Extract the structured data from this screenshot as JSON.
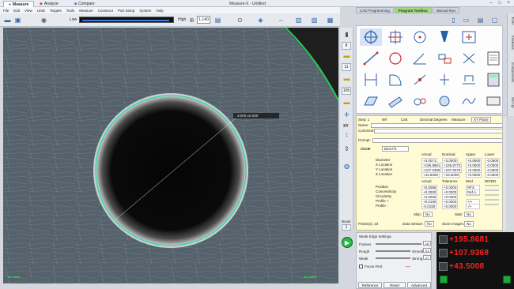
{
  "titlebar": {
    "tabs": [
      "Measure",
      "Analyze",
      "Compare"
    ],
    "app_title": "Measure-X - Untitled"
  },
  "menu": [
    "File",
    "Edit",
    "View",
    "Units",
    "Targets",
    "Tools",
    "Measure",
    "Construct",
    "Part Setup",
    "System",
    "Help"
  ],
  "toolbar": {
    "low_label": "Low",
    "high_label": "High",
    "zoom_value": "1.140"
  },
  "camera": {
    "overlay_value": "3.000 ±0.000",
    "bottom_left_label": "■■ ■■■■",
    "bottom_right_label": "■■ ■■■■"
  },
  "right_tabs": [
    "CAD Programming",
    "Program Toolbox",
    "Manual Run"
  ],
  "vtoolbar": {
    "values": [
      "8",
      "11",
      "105"
    ],
    "xy_label": "XY"
  },
  "side_tabs": [
    "Tools",
    "Features",
    "Components",
    "Set Up"
  ],
  "measure": {
    "header": {
      "step_label": "Step: 1",
      "nr": "NR",
      "cart": "Cart",
      "decimal": "Decimal Degrees",
      "measure": "Measure",
      "plane": "XY Plane"
    },
    "name_label": "Name:",
    "comment_label": "Comment:",
    "prompt_label": "Prompt:",
    "feature_type": "Circle",
    "feature_kind": "Best Fit",
    "columns": [
      "Actual",
      "Nominal",
      "Upper",
      "Lower"
    ],
    "rows": [
      {
        "label": "Diameter",
        "actual": "+3.0071",
        "nominal": "+3.0000",
        "upper": "+0.0500",
        "lower": "-0.0500"
      },
      {
        "label": "X Location",
        "actual": "+195.8681",
        "nominal": "+195.8773",
        "upper": "+0.0500",
        "lower": "-0.0500"
      },
      {
        "label": "Y Location",
        "actual": "+107.9368",
        "nominal": "+107.9378",
        "upper": "+0.0500",
        "lower": "-0.0500"
      },
      {
        "label": "Z Location",
        "actual": "+43.5008",
        "nominal": "+43.5008",
        "upper": "+0.0500",
        "lower": "-0.0500"
      }
    ],
    "columns2": [
      "Actual",
      "Tolerance",
      "Mod",
      "DD/DD"
    ],
    "rows2": [
      {
        "label": "Position",
        "actual": "+0.0068",
        "tolerance": "+0.0000",
        "mod": "RFS",
        "dd": ""
      },
      {
        "label": "Concentricity",
        "actual": "+0.0000",
        "tolerance": "+0.0000",
        "mod": "Ref A",
        "dd": ""
      },
      {
        "label": "Circularity",
        "actual": "+0.0006",
        "tolerance": "+0.0000",
        "mod": "",
        "dd": ""
      },
      {
        "label": "Profile +",
        "actual": "+0.0190",
        "tolerance": "+0.0000",
        "mod": "+/+",
        "dd": ""
      },
      {
        "label": "Profile -",
        "actual": "-0.0190",
        "tolerance": "+0.0000",
        "mod": "-/+",
        "dd": ""
      }
    ],
    "skip_label": "Skip:",
    "skip_value": "No",
    "side_label": "Side:",
    "side_value": "No",
    "points_label": "Points(s): 23",
    "data_stream_label": "Data Stream:",
    "data_stream_value": "No",
    "store_images_label": "Store Images:",
    "store_images_value": "No"
  },
  "edge": {
    "title": "Weak Edge Settings",
    "frames_label": "Frames",
    "frames_value": "16",
    "rough_label": "Rough",
    "smooth_label": "Smooth",
    "rough_value": "91",
    "weak_label": "Weak",
    "strong_label": "Strong",
    "weak_value": "27",
    "focus_label": "Focus First",
    "buttons": [
      "Reference",
      "Reset",
      "Advanced"
    ],
    "boost_label": "Boost",
    "boost_value": "1"
  },
  "dro": {
    "x": "+195.8681",
    "y": "+107.9368",
    "z": "+43.5008"
  },
  "colors": {
    "dro_text": "#ff2020",
    "accent_green": "#1fa53a",
    "tab_active": "#9fdc7a"
  }
}
